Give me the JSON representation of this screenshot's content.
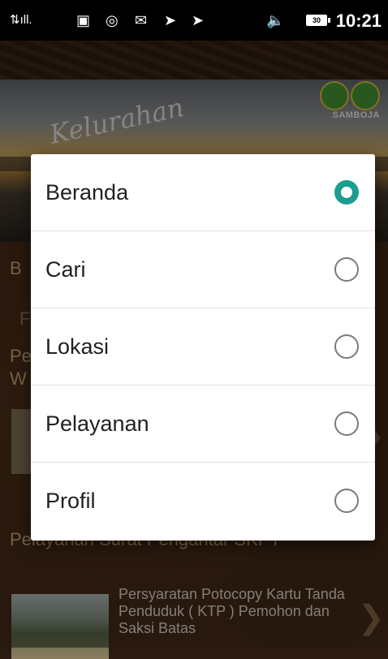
{
  "status_bar": {
    "time": "10:21",
    "battery": "30"
  },
  "banner": {
    "script_text": "Kelurahan",
    "brand": "SAMBOJA"
  },
  "background": {
    "partial_letters": [
      "B",
      "F",
      "Pe",
      "W"
    ],
    "card_title": "Pelayanan Surat Pengantar SKPT",
    "item_text": "Persyaratan Potocopy Kartu Tanda Penduduk ( KTP ) Pemohon dan Saksi Batas"
  },
  "dialog": {
    "options": [
      {
        "label": "Beranda",
        "checked": true
      },
      {
        "label": "Cari",
        "checked": false
      },
      {
        "label": "Lokasi",
        "checked": false
      },
      {
        "label": "Pelayanan",
        "checked": false
      },
      {
        "label": "Profil",
        "checked": false
      }
    ],
    "accent": "#1b9d8f"
  }
}
